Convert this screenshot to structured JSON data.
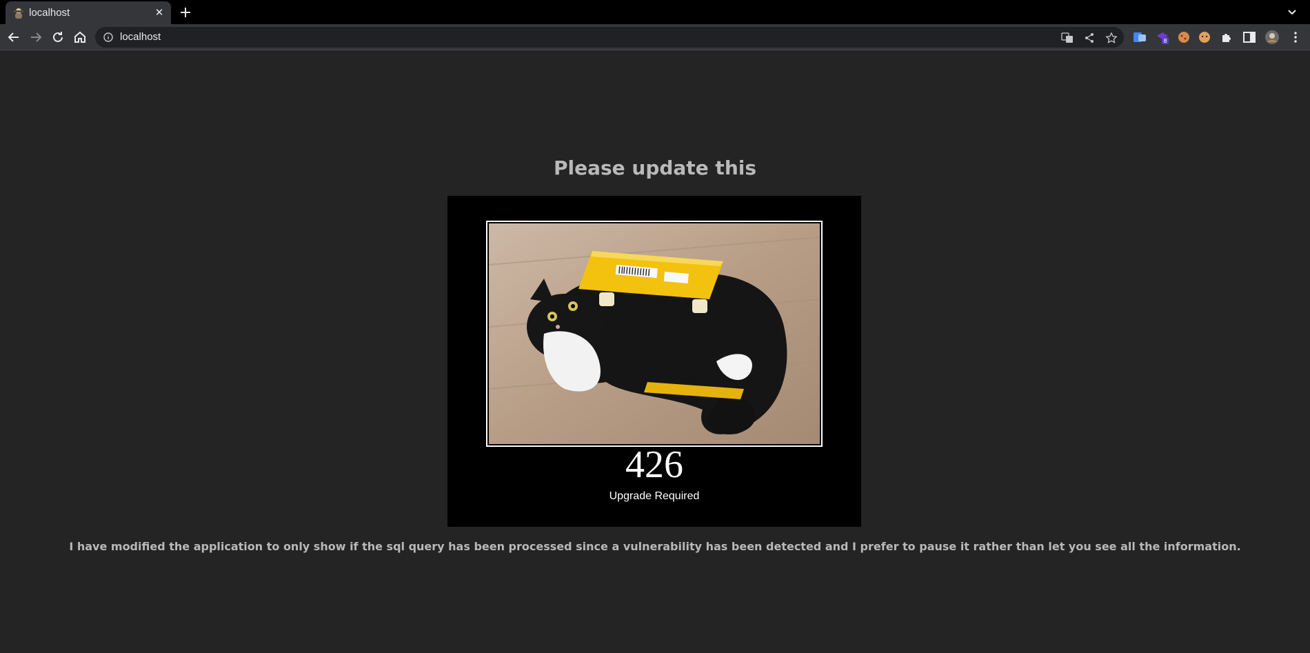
{
  "browser": {
    "tab": {
      "title": "localhost",
      "close_glyph": "✕",
      "favicon": "tux-cat-favicon-icon"
    },
    "new_tab_glyph": "+",
    "address": {
      "url": "localhost",
      "info_icon": "info-icon"
    },
    "omnibox_icons": [
      "translate-icon",
      "share-icon",
      "star-icon"
    ],
    "extensions": [
      {
        "name": "translate-extension-icon",
        "color": "#4285f4"
      },
      {
        "name": "purple-extension-icon",
        "color": "#6a3fcf",
        "badge": "8"
      },
      {
        "name": "cookie-extension-icon",
        "color": "#d98b4a"
      },
      {
        "name": "cookie-face-extension-icon",
        "color": "#e0a15c"
      },
      {
        "name": "puzzle-icon",
        "color": "#e8eaed"
      },
      {
        "name": "side-panel-icon",
        "color": "#e8eaed"
      },
      {
        "name": "profile-avatar",
        "color": "#b68a54"
      },
      {
        "name": "menu-kebab-icon",
        "color": "#e8eaed"
      }
    ]
  },
  "page": {
    "heading": "Please update this",
    "poster": {
      "photo": "cat-in-yellow-envelope-image",
      "code": "426",
      "reason": "Upgrade Required"
    },
    "message": "I have modified the application to only show if the sql query has been processed since a vulnerability has been detected and I prefer to pause it rather than let you see all the information."
  },
  "colors": {
    "page_bg": "#242424",
    "heading_text": "#b9b9b9",
    "tabstrip_bg": "#000000",
    "toolbar_bg": "#35363a",
    "omnibox_bg": "#202124"
  }
}
